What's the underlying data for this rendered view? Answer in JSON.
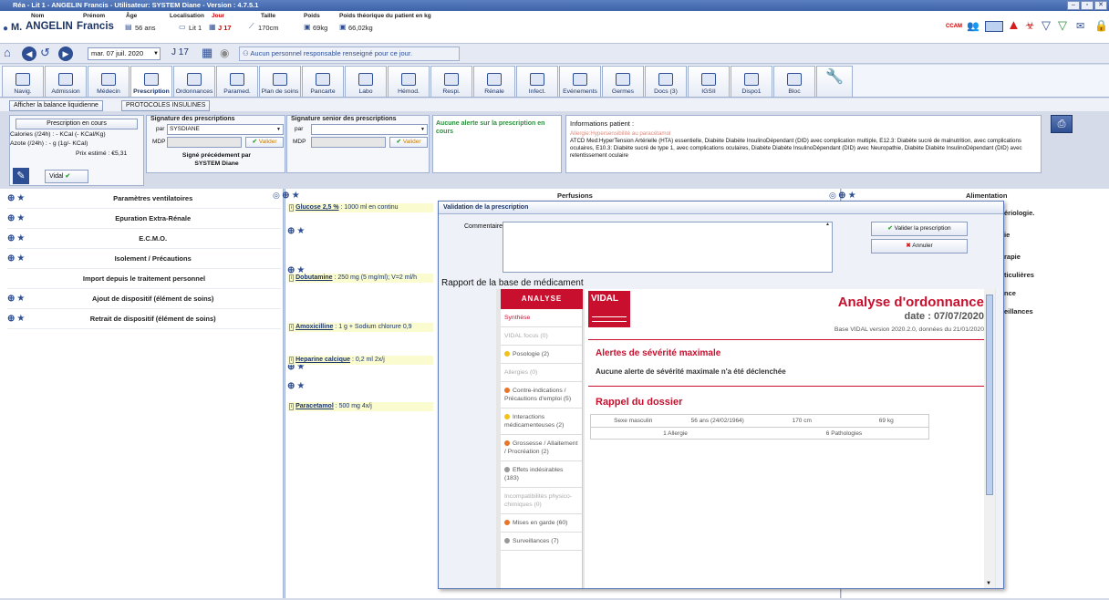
{
  "window": {
    "title": "Réa - Lit 1 - ANGELIN Francis - Utilisateur: SYSTEM Diane - Version : 4.7.5.1"
  },
  "patient": {
    "civ": "M.",
    "nom_label": "Nom",
    "nom": "ANGELIN",
    "prenom_label": "Prénom",
    "prenom": "Francis",
    "age_label": "Âge",
    "age": "56 ans",
    "loc_label": "Localisation",
    "loc": "Lit 1",
    "jour_label": "Jour",
    "jour": "J 17",
    "taille_label": "Taille",
    "taille": "170cm",
    "poids_label": "Poids",
    "poids": "69kg",
    "poids_theo_label": "Poids théorique du patient en kg",
    "poids_theo": "66,02kg",
    "ccam": "CCAM"
  },
  "nav": {
    "date": "mar. 07 juil. 2020",
    "jour": "J 17",
    "message": "Aucun personnel responsable renseigné pour ce jour."
  },
  "tabs": [
    "Navig.",
    "Admission",
    "Médecin",
    "Prescription",
    "Ordonnances",
    "Paramed.",
    "Plan de soins",
    "Pancarte",
    "Labo",
    "Hémod.",
    "Respi.",
    "Rénale",
    "Infect.",
    "Evénements",
    "Germes",
    "Docs (3)",
    "IGSII",
    "Dispo1",
    "Bloc"
  ],
  "active_tab": "Prescription",
  "toolbar": {
    "balance": "Afficher la balance liquidienne",
    "protocoles": "PROTOCOLES INSULINES"
  },
  "presc": {
    "title": "Prescription en cours",
    "calories": "Calories (/24h) : - KCal (- KCal/Kg)",
    "azote": "Azote (/24h) : - g (1g/- KCal)",
    "prix": "Prix estimé : €5,31",
    "vidal": "Vidal",
    "sig_title": "Signature des prescriptions",
    "par": "par",
    "sig_value": "SYSDIANE",
    "mdp": "MDP",
    "valider": "Valider",
    "signed_by": "Signé précédement par",
    "signed_name": "SYSTEM Diane",
    "senior_title": "Signature senior des prescriptions",
    "alert": "Aucune alerte sur la prescription en cours",
    "info_title": "Informations patient :",
    "allergy": "Allergie:Hypersensibilité au paracétamol",
    "atcd": "ATCD Med:HyperTension Artérielle (HTA) essentielle, Diabète Diabète InsulinoDépendant (DID) avec complication multiple, E12.3: Diabète sucré de malnutrition, avec complications oculaires, E10.3: Diabète sucré de type 1, avec complications oculaires, Diabète Diabète InsulinoDépendant (DID) avec Neuropathie, Diabète Diabète InsulinoDépendant (DID) avec retentissement oculaire"
  },
  "left_rows": [
    {
      "label": "Paramètres ventilatoires",
      "icons": true
    },
    {
      "label": "Epuration Extra-Rénale",
      "icons": true
    },
    {
      "label": "E.C.M.O.",
      "icons": true
    },
    {
      "label": "Isolement / Précautions",
      "icons": true
    },
    {
      "label": "Import depuis le traitement personnel",
      "icons": false
    },
    {
      "label": "Ajout de dispositif (élément de soins)",
      "icons": true
    },
    {
      "label": "Retrait de dispositif (élément de soins)",
      "icons": true
    }
  ],
  "mid_header": "Perfusions",
  "right_header": "Alimentation",
  "right_cuts": [
    "ériologie.",
    "ie",
    "rapie",
    "ticulières",
    "nce",
    "eillances"
  ],
  "meds": [
    {
      "name": "Glucose 2,5 %",
      "rest": " : 1000 ml  en continu"
    },
    {
      "name": "Dobutamine",
      "rest": " : 250 mg (5 mg/ml); V=2 ml/h"
    },
    {
      "name": "Amoxicilline",
      "rest": " : 1 g + Sodium chlorure 0,9"
    },
    {
      "name": "Heparine calcique",
      "rest": " : 0,2 ml 2x/j"
    },
    {
      "name": "Paracetamol",
      "rest": " : 500 mg 4x/j"
    }
  ],
  "modal": {
    "title": "Validation de la prescription",
    "commentaire": "Commentaire",
    "valider": "Valider la prescription",
    "annuler": "Annuler",
    "rapport": "Rapport de la base de médicament"
  },
  "vidal": {
    "analyse": "ANALYSE",
    "logo": "VIDAL",
    "menu": [
      {
        "label": "Synthèse",
        "color": "",
        "active": true
      },
      {
        "label": "VIDAL focus (0)",
        "color": "",
        "active": false
      },
      {
        "label": "Posologie (2)",
        "color": "#f0c21a",
        "active": false
      },
      {
        "label": "Allergies (0)",
        "color": "",
        "active": false
      },
      {
        "label": "Contre-indications / Précautions d'emploi (5)",
        "color": "#e8762a",
        "active": false
      },
      {
        "label": "Interactions médicamenteuses (2)",
        "color": "#f0c21a",
        "active": false
      },
      {
        "label": "Grossesse / Allaitement / Procréation (2)",
        "color": "#e8762a",
        "active": false
      },
      {
        "label": "Effets indésirables (183)",
        "color": "#999",
        "active": false
      },
      {
        "label": "Incompatibilités physico-chimiques (0)",
        "color": "",
        "active": false
      },
      {
        "label": "Mises en garde (60)",
        "color": "#e8762a",
        "active": false
      },
      {
        "label": "Surveillances (7)",
        "color": "#999",
        "active": false
      }
    ],
    "title": "Analyse d'ordonnance",
    "date": "date : 07/07/2020",
    "base": "Base VIDAL version 2020.2.0, données du 21/01/2020",
    "alert_title": "Alertes de sévérité maximale",
    "alert_text": "Aucune alerte de sévérité maximale n'a été déclenchée",
    "rappel": "Rappel du dossier",
    "sexe": "Sexe masculin",
    "age": "56 ans  (24/02/1964)",
    "taille": "170  cm",
    "poids": "69  kg",
    "allergie": "1 Allergie",
    "patho": "6 Pathologies"
  }
}
